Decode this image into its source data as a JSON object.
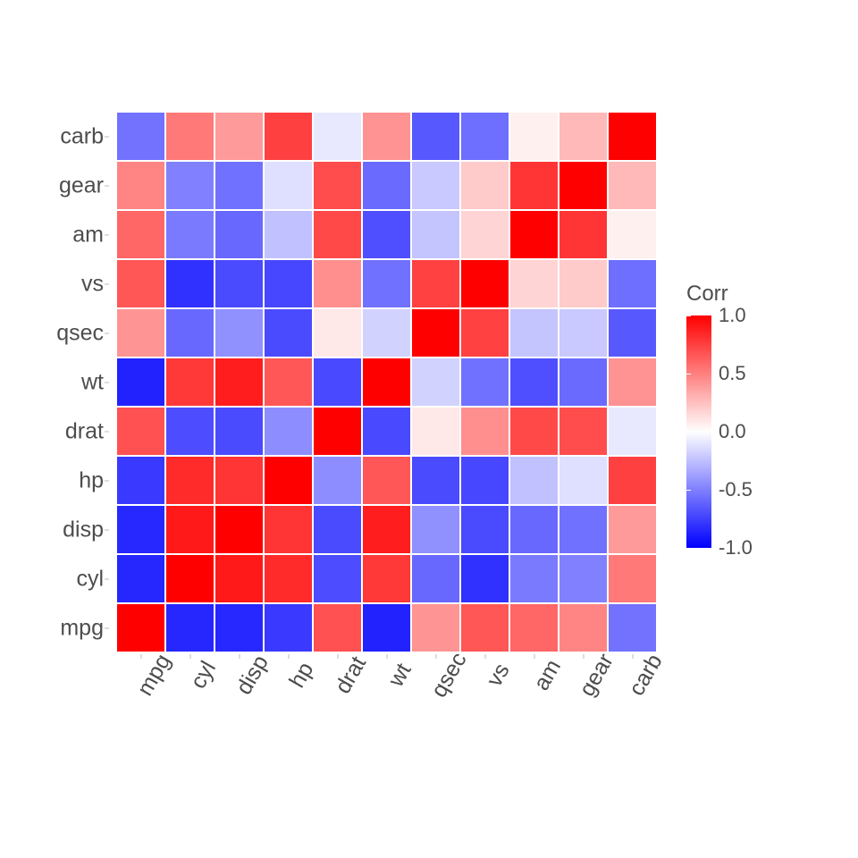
{
  "chart_data": {
    "type": "heatmap",
    "variables": [
      "mpg",
      "cyl",
      "disp",
      "hp",
      "drat",
      "wt",
      "qsec",
      "vs",
      "am",
      "gear",
      "carb"
    ],
    "legend_title": "Corr",
    "legend_ticks": [
      1.0,
      0.5,
      0.0,
      -0.5,
      -1.0
    ],
    "color_low": "#0000ff",
    "color_mid": "#ffffff",
    "color_high": "#ff0000",
    "matrix": [
      [
        1.0,
        -0.852,
        -0.848,
        -0.776,
        0.681,
        -0.868,
        0.419,
        0.664,
        0.6,
        0.48,
        -0.551
      ],
      [
        -0.852,
        1.0,
        0.902,
        0.832,
        -0.7,
        0.782,
        -0.591,
        -0.811,
        -0.523,
        -0.493,
        0.527
      ],
      [
        -0.848,
        0.902,
        1.0,
        0.791,
        -0.71,
        0.888,
        -0.434,
        -0.71,
        -0.591,
        -0.556,
        0.395
      ],
      [
        -0.776,
        0.832,
        0.791,
        1.0,
        -0.449,
        0.659,
        -0.708,
        -0.723,
        -0.243,
        -0.126,
        0.75
      ],
      [
        0.681,
        -0.7,
        -0.71,
        -0.449,
        1.0,
        -0.712,
        0.091,
        0.44,
        0.713,
        0.7,
        -0.091
      ],
      [
        -0.868,
        0.782,
        0.888,
        0.659,
        -0.712,
        1.0,
        -0.175,
        -0.555,
        -0.692,
        -0.583,
        0.428
      ],
      [
        0.419,
        -0.591,
        -0.434,
        -0.708,
        0.091,
        -0.175,
        1.0,
        0.745,
        -0.23,
        -0.213,
        -0.656
      ],
      [
        0.664,
        -0.811,
        -0.71,
        -0.723,
        0.44,
        -0.555,
        0.745,
        1.0,
        0.168,
        0.206,
        -0.57
      ],
      [
        0.6,
        -0.523,
        -0.591,
        -0.243,
        0.713,
        -0.692,
        -0.23,
        0.168,
        1.0,
        0.794,
        0.058
      ],
      [
        0.48,
        -0.493,
        -0.556,
        -0.126,
        0.7,
        -0.583,
        -0.213,
        0.206,
        0.794,
        1.0,
        0.274
      ],
      [
        -0.551,
        0.527,
        0.395,
        0.75,
        -0.091,
        0.428,
        -0.656,
        -0.57,
        0.058,
        0.274,
        1.0
      ]
    ]
  }
}
